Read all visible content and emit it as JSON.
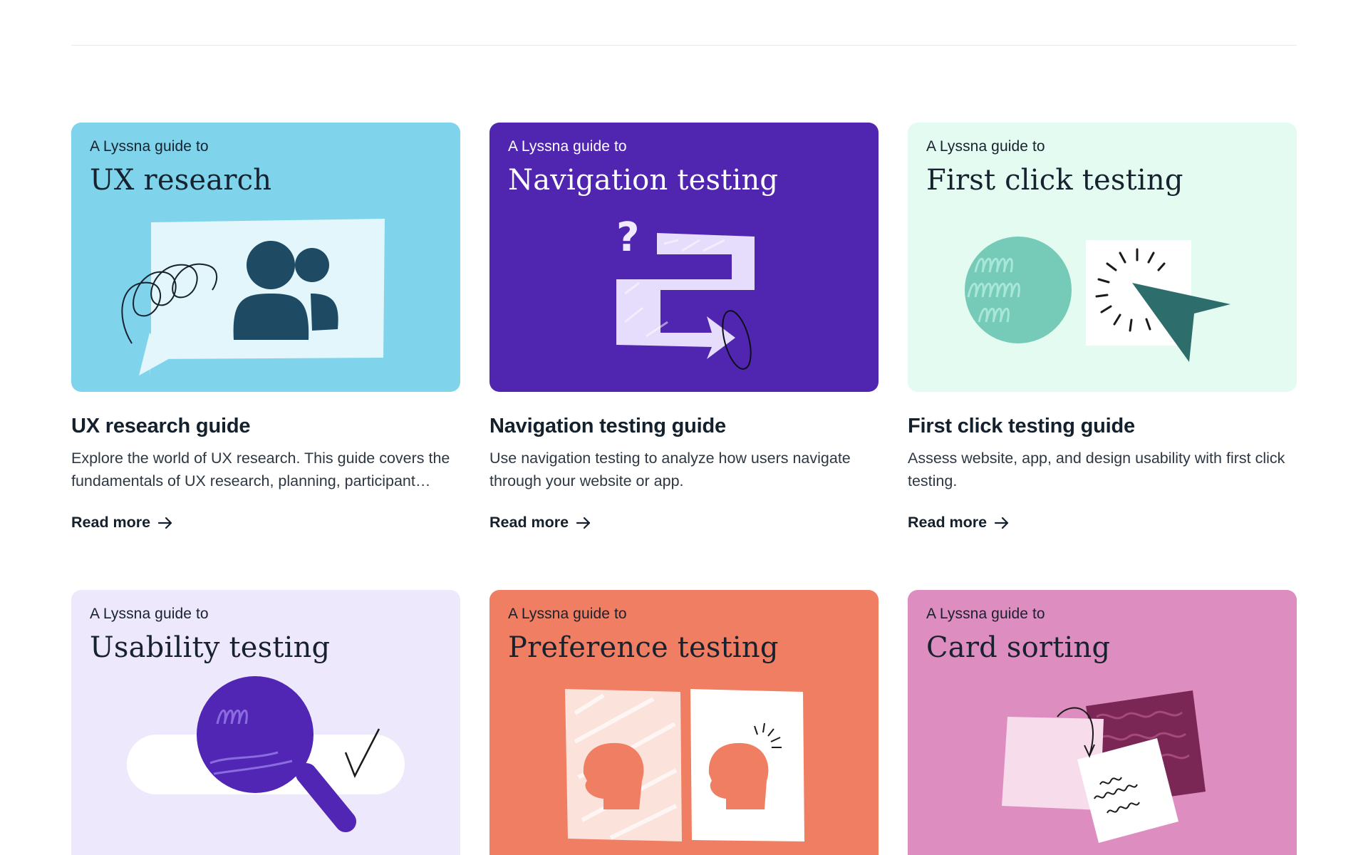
{
  "colors": {
    "ux_research_bg": "#7fd4ec",
    "navigation_bg": "#5026b0",
    "first_click_bg": "#e3fbf0",
    "usability_bg": "#ede8fb",
    "preference_bg": "#ef7e62",
    "card_sorting_bg": "#de8dc0",
    "heading_text": "#14202c",
    "body_text": "#2c3743"
  },
  "guides": [
    {
      "kicker": "A Lyssna guide to",
      "hero_title": "UX research",
      "title": "UX research guide",
      "description": "Explore the world of UX research. This guide covers the fundamentals of UX research, planning, participant recruitment and more.",
      "link": "Read more",
      "illustration": "people-icon"
    },
    {
      "kicker": "A Lyssna guide to",
      "hero_title": "Navigation testing",
      "title": "Navigation testing guide",
      "description": "Use navigation testing to analyze how users navigate through your website or app.",
      "link": "Read more",
      "illustration": "path-arrow-icon"
    },
    {
      "kicker": "A Lyssna guide to",
      "hero_title": "First click testing",
      "title": "First click testing guide",
      "description": "Assess website, app, and design usability with first click testing.",
      "link": "Read more",
      "illustration": "cursor-click-icon"
    },
    {
      "kicker": "A Lyssna guide to",
      "hero_title": "Usability testing",
      "illustration": "magnifier-icon"
    },
    {
      "kicker": "A Lyssna guide to",
      "hero_title": "Preference testing",
      "illustration": "heads-comparison-icon"
    },
    {
      "kicker": "A Lyssna guide to",
      "hero_title": "Card sorting",
      "illustration": "cards-icon"
    }
  ]
}
